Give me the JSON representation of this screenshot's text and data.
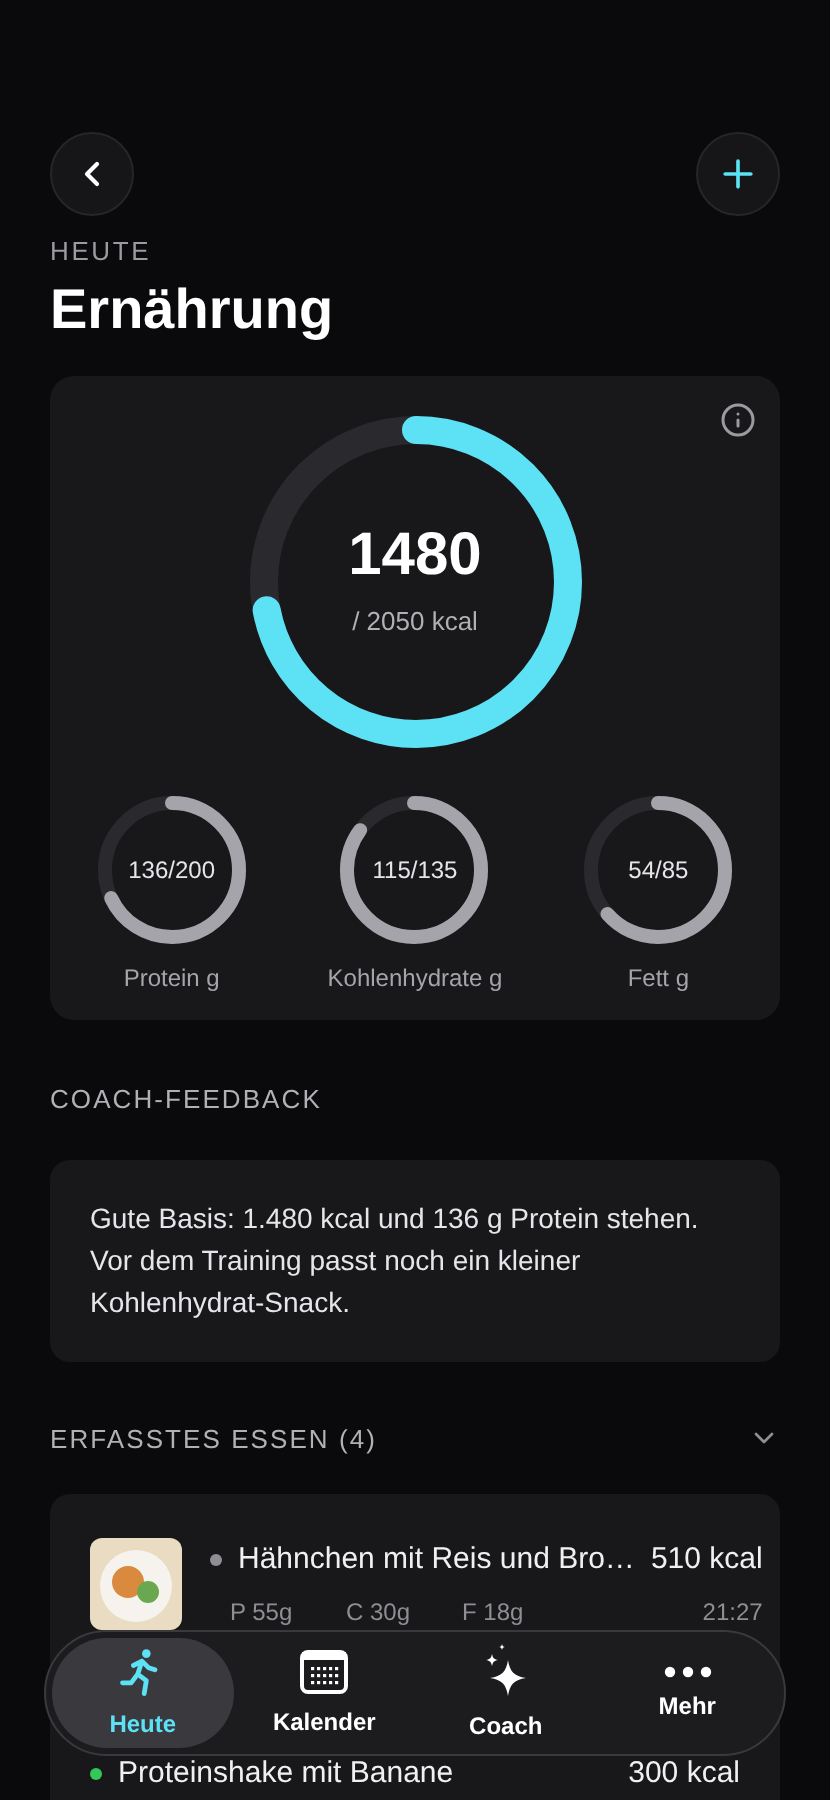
{
  "header": {
    "eyebrow": "HEUTE",
    "title": "Ernährung"
  },
  "calories": {
    "value": "1480",
    "target": "/ 2050 kcal"
  },
  "macros": [
    {
      "reading": "136/200",
      "label": "Protein g"
    },
    {
      "reading": "115/135",
      "label": "Kohlenhydrate g"
    },
    {
      "reading": "54/85",
      "label": "Fett g"
    }
  ],
  "coach_feedback": {
    "heading": "COACH-FEEDBACK",
    "text": "Gute Basis: 1.480 kcal und 136 g Protein stehen. Vor dem Training passt noch ein kleiner Kohlenhydrat-Snack."
  },
  "meals": {
    "heading": "ERFASSTES ESSEN (4)",
    "expanded": true,
    "items": [
      {
        "name": "Hähnchen mit Reis und Bro…",
        "kcal": "510 kcal",
        "color": "#8e8e93",
        "protein": "P 55g",
        "carbs": "C 30g",
        "fat": "F 18g",
        "time": "21:27"
      },
      {
        "name": "Proteinshake mit Banane",
        "kcal": "300 kcal",
        "color": "#34c759"
      }
    ]
  },
  "tab_bar": [
    {
      "label": "Heute",
      "selected": true,
      "kind": "run"
    },
    {
      "label": "Kalender",
      "selected": false,
      "kind": "calendar"
    },
    {
      "label": "Coach",
      "selected": false,
      "kind": "sparkle"
    },
    {
      "label": "Mehr",
      "selected": false,
      "kind": "more"
    }
  ]
}
